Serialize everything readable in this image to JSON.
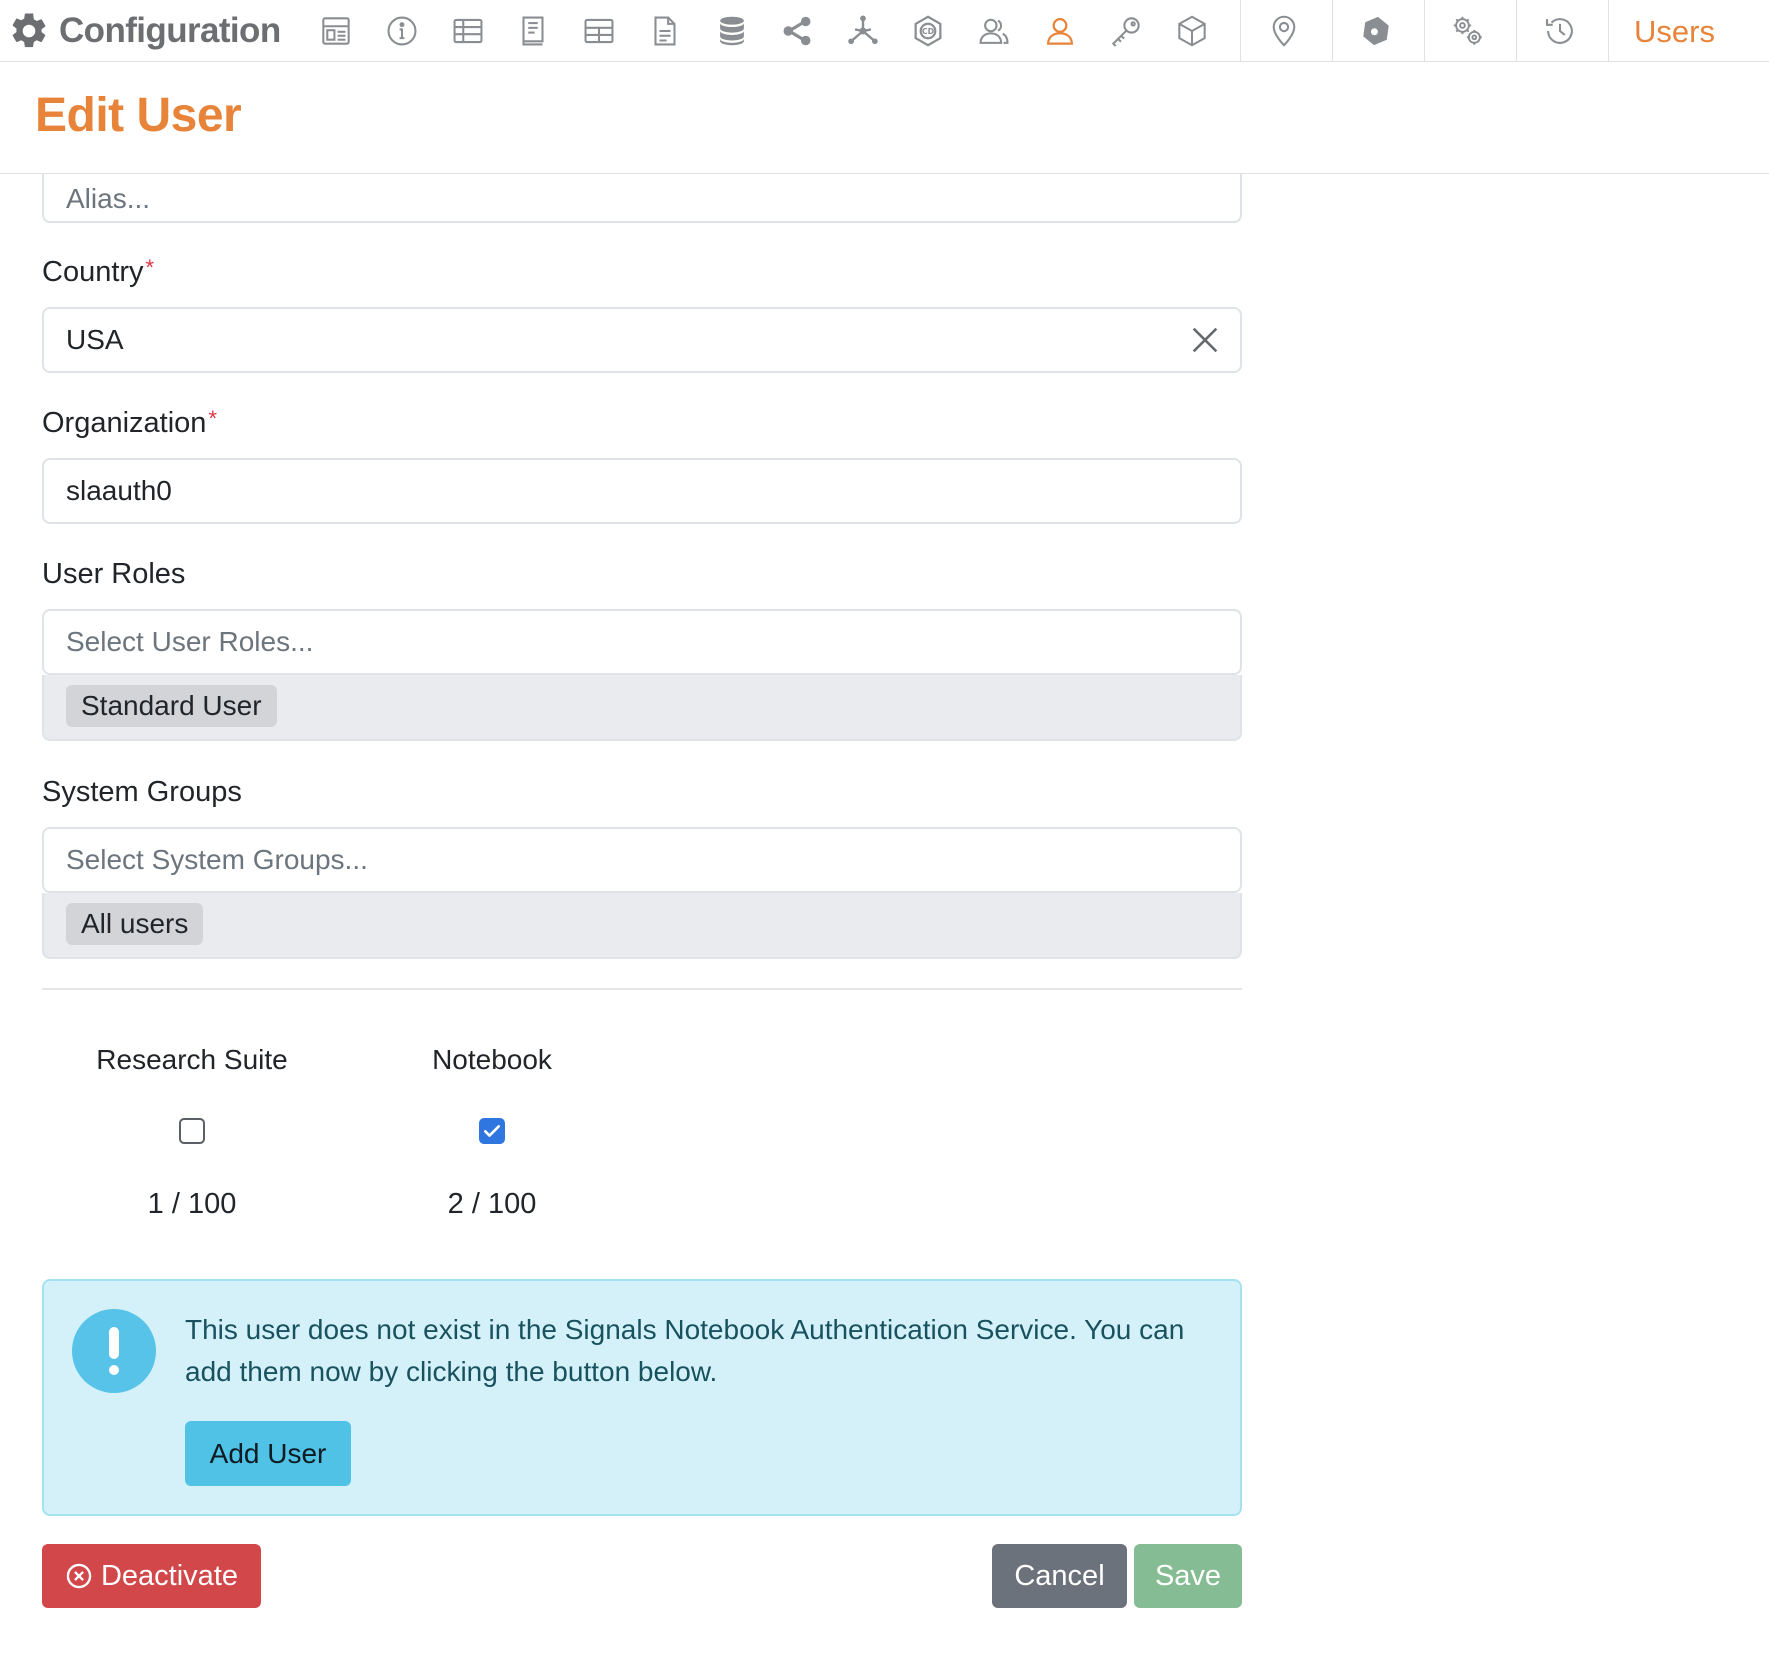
{
  "header": {
    "app_title": "Configuration",
    "current_section": "Users",
    "toolbar_icons": [
      "layout-icon",
      "info-icon",
      "table-icon",
      "notebook-icon",
      "grid-icon",
      "document-icon",
      "database-icon",
      "share-icon",
      "network-icon",
      "cd-icon",
      "users-icon",
      "user-icon",
      "key-icon",
      "cube-icon",
      "location-icon",
      "shield-icon",
      "settings-icon",
      "history-icon"
    ],
    "accent_color": "#e8843a"
  },
  "page": {
    "title": "Edit User"
  },
  "form": {
    "alias": {
      "placeholder": "Alias..."
    },
    "country": {
      "label": "Country",
      "required_marker": "*",
      "value": "USA"
    },
    "organization": {
      "label": "Organization",
      "required_marker": "*",
      "value": "slaauth0"
    },
    "user_roles": {
      "label": "User Roles",
      "placeholder": "Select User Roles...",
      "selected": [
        "Standard User"
      ]
    },
    "system_groups": {
      "label": "System Groups",
      "placeholder": "Select System Groups...",
      "selected": [
        "All users"
      ]
    }
  },
  "licenses": [
    {
      "name": "Research Suite",
      "checked": false,
      "usage": "1 / 100"
    },
    {
      "name": "Notebook",
      "checked": true,
      "usage": "2 / 100"
    }
  ],
  "alert": {
    "message": "This user does not exist in the Signals Notebook Authentication Service. You can add them now by clicking the button below.",
    "button_label": "Add User"
  },
  "actions": {
    "deactivate_label": "Deactivate",
    "cancel_label": "Cancel",
    "save_label": "Save"
  }
}
